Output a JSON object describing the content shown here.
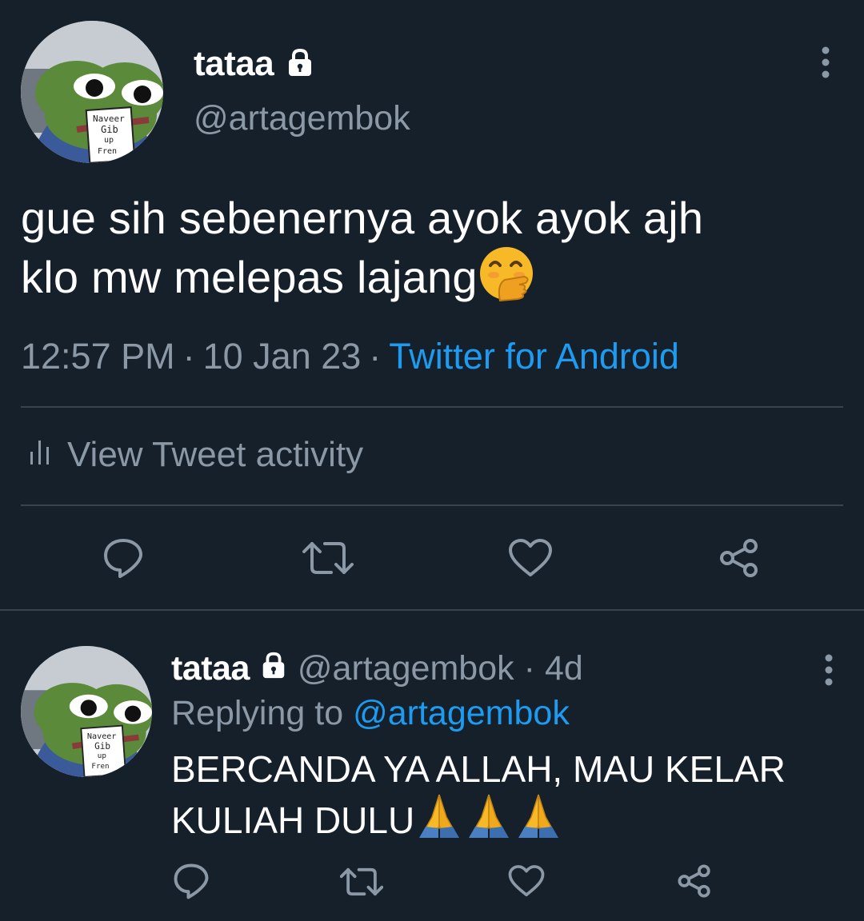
{
  "colors": {
    "background": "#15202b",
    "text": "#ffffff",
    "muted": "#8b98a5",
    "link": "#1d9bf0",
    "divider": "#38444d"
  },
  "tweet": {
    "avatar_icon": "pepe-frog-avatar",
    "avatar_sign_text": "Naveer Gib up Fren",
    "display_name": "tataa",
    "protected_icon": "lock-icon",
    "handle": "@artagembok",
    "more_icon": "vertical-ellipsis-icon",
    "text_line1": "gue sih sebenernya ayok ayok ajh",
    "text_line2": "klo mw melepas lajang",
    "emoji": "hand-over-mouth-emoji",
    "time": "12:57 PM",
    "separator": "·",
    "date": "10 Jan 23",
    "source": "Twitter for Android",
    "activity_label": "View Tweet activity",
    "activity_icon": "bar-chart-icon",
    "actions": [
      "reply-icon",
      "retweet-icon",
      "like-icon",
      "share-icon"
    ]
  },
  "reply": {
    "display_name": "tataa",
    "protected_icon": "lock-icon",
    "handle": "@artagembok",
    "separator": "·",
    "age": "4d",
    "replying_prefix": "Replying to",
    "replying_to": "@artagembok",
    "text_line1": "BERCANDA YA ALLAH, MAU KELAR",
    "text_line2": "KULIAH DULU",
    "emoji": "folded-hands-emoji",
    "emoji_count": 3,
    "actions": [
      "reply-icon",
      "retweet-icon",
      "like-icon",
      "share-icon"
    ]
  }
}
